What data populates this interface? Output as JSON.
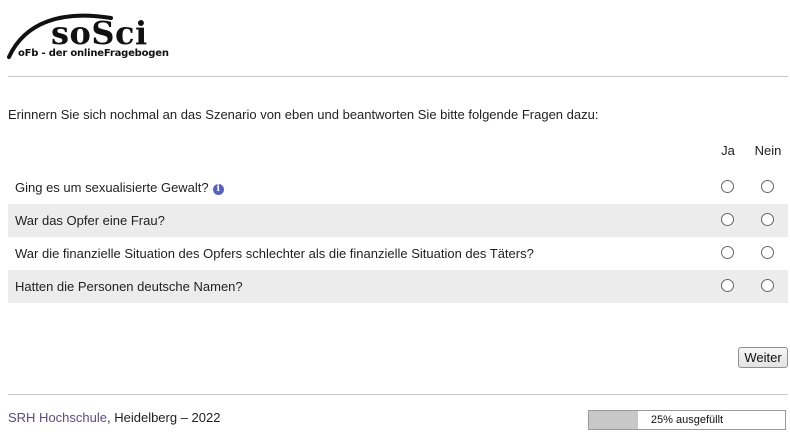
{
  "logo": {
    "wordmark": "soSci",
    "tagline": "oFb - der onlineFragebogen"
  },
  "instruction": "Erinnern Sie sich nochmal an das Szenario von eben und beantworten Sie bitte folgende Fragen dazu:",
  "columns": {
    "yes": "Ja",
    "no": "Nein"
  },
  "questions": [
    {
      "text": "Ging es um sexualisierte Gewalt?",
      "has_info": true
    },
    {
      "text": "War das Opfer eine Frau?",
      "has_info": false
    },
    {
      "text": "War die finanzielle Situation des Opfers schlechter als die finanzielle Situation des Täters?",
      "has_info": false
    },
    {
      "text": "Hatten die Personen deutsche Namen?",
      "has_info": false
    }
  ],
  "next_button": "Weiter",
  "footer": {
    "link": "SRH Hochschule",
    "rest": ", Heidelberg – 2022"
  },
  "progress": {
    "percent": 25,
    "label": "25% ausgefüllt"
  },
  "colors": {
    "alt_row": "#ececec",
    "footer_link": "#5a4a8a",
    "info_icon": "#5561c8",
    "progress_fill": "#c8c8c8"
  }
}
